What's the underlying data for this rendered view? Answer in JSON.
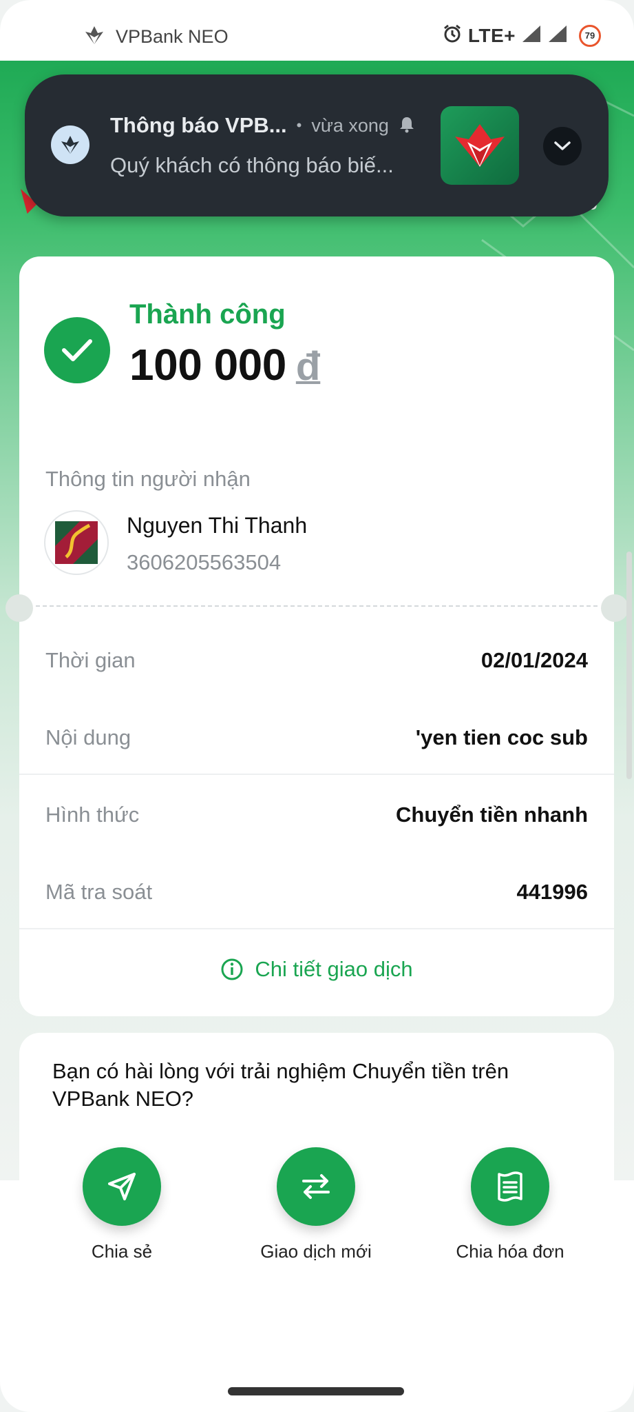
{
  "status_bar": {
    "app_name": "VPBank NEO",
    "network": "LTE+",
    "battery": "79"
  },
  "notification": {
    "title": "Thông báo VPB...",
    "separator": "•",
    "time": "vừa xong",
    "body": "Quý khách có thông báo biế...",
    "peek_text": "g"
  },
  "transaction": {
    "status": "Thành công",
    "amount": "100 000",
    "currency": "đ",
    "recipient_section_label": "Thông tin người nhận",
    "recipient_name": "Nguyen Thi Thanh",
    "recipient_account": "3606205563504",
    "rows": [
      {
        "label": "Thời gian",
        "value": "02/01/2024"
      },
      {
        "label": "Nội dung",
        "value": "'yen tien coc sub"
      },
      {
        "label": "Hình thức",
        "value": "Chuyển tiền nhanh"
      },
      {
        "label": "Mã tra soát",
        "value": "441996"
      }
    ],
    "detail_link": "Chi tiết giao dịch"
  },
  "feedback": {
    "question": "Bạn có hài lòng với trải nghiệm Chuyển tiền trên VPBank NEO?"
  },
  "actions": [
    {
      "label": "Chia sẻ",
      "icon": "share-send-icon"
    },
    {
      "label": "Giao dịch mới",
      "icon": "swap-arrows-icon"
    },
    {
      "label": "Chia hóa đơn",
      "icon": "receipt-icon"
    }
  ],
  "colors": {
    "brand_green": "#1aa551",
    "notification_bg": "#262c33",
    "brand_red": "#d6262e"
  }
}
